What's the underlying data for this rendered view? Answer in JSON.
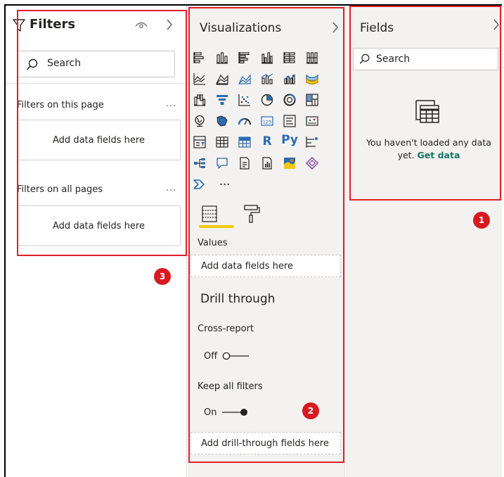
{
  "filters": {
    "title": "Filters",
    "search_placeholder": "Search",
    "on_this_page_label": "Filters on this page",
    "on_all_pages_label": "Filters on all pages",
    "more": "...",
    "drop_label": "Add data fields here"
  },
  "visualizations": {
    "title": "Visualizations",
    "more": "...",
    "values_label": "Values",
    "values_drop": "Add data fields here",
    "drill_title": "Drill through",
    "cross_report_label": "Cross-report",
    "cross_report_state": "Off",
    "keep_filters_label": "Keep all filters",
    "keep_filters_state": "On",
    "drill_drop": "Add drill-through fields here",
    "r_icon": "R",
    "py_icon": "Py"
  },
  "fields": {
    "title": "Fields",
    "search_placeholder": "Search",
    "empty_message": "You haven't loaded any data yet.",
    "get_data_link": "Get data"
  },
  "callouts": {
    "fields_badge": "1",
    "viz_badge": "2",
    "filters_badge": "3"
  },
  "colors": {
    "accent_yellow": "#f2c811",
    "callout_red": "#e0202a",
    "link_teal": "#117865",
    "pane_bg": "#f3f2f1"
  }
}
